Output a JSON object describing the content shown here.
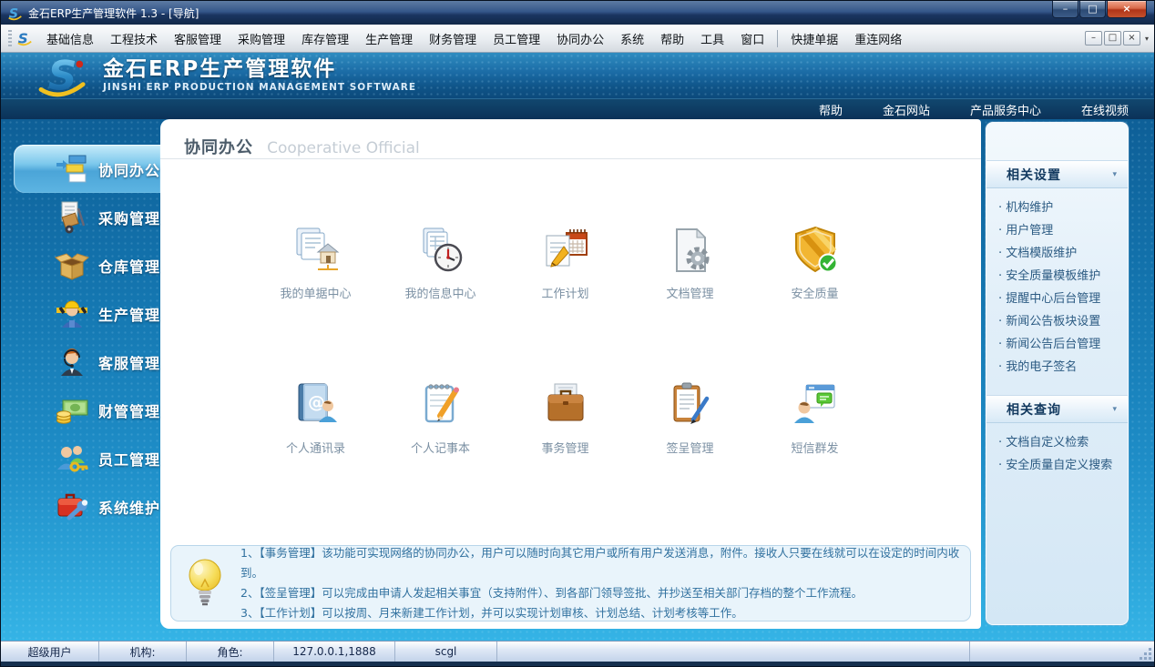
{
  "window": {
    "title": "金石ERP生产管理软件 1.3 - [导航]"
  },
  "icons": {
    "minimize": "–",
    "maximize": "□",
    "restore": "□",
    "close": "×",
    "section_chevron": "▾",
    "menu_overflow": "▾"
  },
  "menu_bar": {
    "items": [
      "基础信息",
      "工程技术",
      "客服管理",
      "采购管理",
      "库存管理",
      "生产管理",
      "财务管理",
      "员工管理",
      "协同办公",
      "系统",
      "帮助",
      "工具",
      "窗口"
    ],
    "extra_items": [
      "快捷单据",
      "重连网络"
    ]
  },
  "header": {
    "title": "金石ERP生产管理软件",
    "subtitle": "JINSHI ERP PRODUCTION MANAGEMENT SOFTWARE",
    "links": [
      "帮助",
      "金石网站",
      "产品服务中心",
      "在线视频"
    ]
  },
  "sidebar": {
    "items": [
      {
        "label": "协同办公",
        "icon": "cooperative-office-icon",
        "selected": true
      },
      {
        "label": "采购管理",
        "icon": "purchase-handtruck-icon",
        "selected": false
      },
      {
        "label": "仓库管理",
        "icon": "warehouse-box-icon",
        "selected": false
      },
      {
        "label": "生产管理",
        "icon": "production-worker-icon",
        "selected": false
      },
      {
        "label": "客服管理",
        "icon": "customer-service-icon",
        "selected": false
      },
      {
        "label": "财管管理",
        "icon": "finance-money-icon",
        "selected": false
      },
      {
        "label": "员工管理",
        "icon": "staff-people-key-icon",
        "selected": false
      },
      {
        "label": "系统维护",
        "icon": "system-toolbox-icon",
        "selected": false
      }
    ]
  },
  "main": {
    "title": "协同办公",
    "subtitle": "Cooperative Official",
    "modules": [
      {
        "label": "我的单据中心",
        "icon": "my-documents-center-icon"
      },
      {
        "label": "我的信息中心",
        "icon": "my-info-center-icon"
      },
      {
        "label": "工作计划",
        "icon": "work-plan-icon"
      },
      {
        "label": "文档管理",
        "icon": "document-manage-icon"
      },
      {
        "label": "安全质量",
        "icon": "safety-quality-shield-icon"
      },
      {
        "label": "个人通讯录",
        "icon": "address-book-icon"
      },
      {
        "label": "个人记事本",
        "icon": "notebook-icon"
      },
      {
        "label": "事务管理",
        "icon": "briefcase-icon"
      },
      {
        "label": "签呈管理",
        "icon": "sign-approval-icon"
      },
      {
        "label": "短信群发",
        "icon": "sms-group-icon"
      }
    ]
  },
  "tips": {
    "lines": [
      "1、【事务管理】该功能可实现网络的协同办公，用户可以随时向其它用户或所有用户发送消息，附件。接收人只要在线就可以在设定的时间内收到。",
      "2、【签呈管理】可以完成由申请人发起相关事宜（支持附件）、到各部门领导签批、并抄送至相关部门存档的整个工作流程。",
      "3、【工作计划】可以按周、月来新建工作计划，并可以实现计划审核、计划总结、计划考核等工作。"
    ]
  },
  "right_panel": {
    "sections": [
      {
        "title": "相关设置",
        "items": [
          "机构维护",
          "用户管理",
          "文档模版维护",
          "安全质量模板维护",
          "提醒中心后台管理",
          "新闻公告板块设置",
          "新闻公告后台管理",
          "我的电子签名"
        ]
      },
      {
        "title": "相关查询",
        "items": [
          "文档自定义检索",
          "安全质量自定义搜索"
        ]
      }
    ]
  },
  "status_bar": {
    "cells": [
      "超级用户",
      "机构:",
      "角色:",
      "127.0.0.1,1888",
      "scgl",
      "",
      ""
    ]
  },
  "colors": {
    "titlebar_navy": "#1a3560",
    "close_red": "#b13418",
    "banner_blue": "#1a6aa4",
    "content_blue": "#1e8dc7",
    "selected_item_blue": "#7cc8ec",
    "shield_gold": "#f0b030",
    "check_green": "#38b838",
    "tip_box_bg": "#e9f4fb",
    "panel_link_blue": "#2b5a82"
  }
}
